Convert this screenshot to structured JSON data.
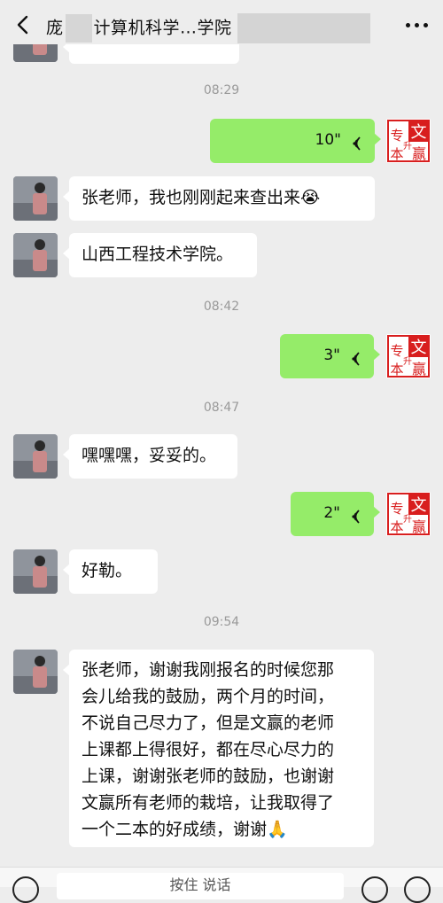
{
  "header": {
    "title_prefix": "庞",
    "title_main": "计算机科学…学院"
  },
  "messages": [
    {
      "id": "m0"
    },
    {
      "id": "t1",
      "time": "08:29"
    },
    {
      "id": "v1",
      "duration": "10\""
    },
    {
      "id": "m1",
      "text": "张老师，我也刚刚起来查出来😭"
    },
    {
      "id": "m2",
      "text": "山西工程技术学院。"
    },
    {
      "id": "t2",
      "time": "08:42"
    },
    {
      "id": "v2",
      "duration": "3\""
    },
    {
      "id": "t3",
      "time": "08:47"
    },
    {
      "id": "m3",
      "text": "嘿嘿嘿，妥妥的。"
    },
    {
      "id": "v3",
      "duration": "2\""
    },
    {
      "id": "m4",
      "text": "好勒。"
    },
    {
      "id": "t4",
      "time": "09:54"
    },
    {
      "id": "m5",
      "lines": [
        "张老师，谢谢我刚报名的时候您那",
        "会儿给我的鼓励，两个月的时间，",
        "不说自己尽力了，但是文赢的老师",
        "上课都上得很好，都在尽心尽力的",
        "上课，谢谢张老师的鼓励，也谢谢",
        "文赢所有老师的栽培，让我取得了",
        "一个二本的好成绩，谢谢🙏"
      ]
    }
  ],
  "stamp": {
    "chars": [
      "文",
      "专",
      "升",
      "本",
      "赢"
    ],
    "color": "#d81e1e"
  },
  "bottom": {
    "input_text": "按住 说话"
  },
  "colors": {
    "background": "#ededed",
    "bubble_self": "#95ec69",
    "bubble_other": "#ffffff"
  }
}
